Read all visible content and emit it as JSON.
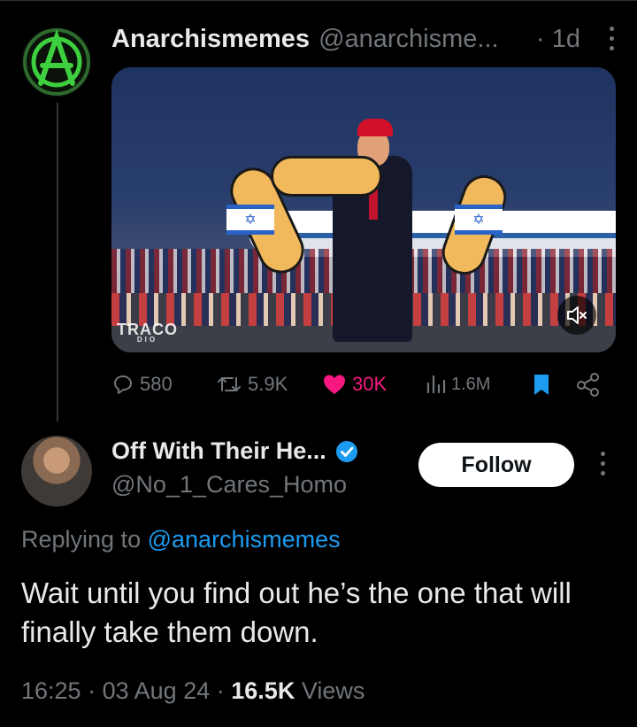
{
  "parent_tweet": {
    "author_name": "Anarchismemes",
    "author_handle": "@anarchisme...",
    "time": "· 1d",
    "video": {
      "watermark": "TRACO",
      "watermark_sub": "DIO"
    },
    "stats": {
      "replies": "580",
      "reposts": "5.9K",
      "likes": "30K",
      "views": "1.6M"
    }
  },
  "reply_tweet": {
    "author_name": "Off With Their He...",
    "author_handle": "@No_1_Cares_Homo",
    "follow_label": "Follow",
    "replying_prefix": "Replying to",
    "replying_handle": "@anarchismemes",
    "text": "Wait until you find out he’s the one that will finally take them down.",
    "time": "16:25",
    "date": "03 Aug 24",
    "views_count": "16.5K",
    "views_label": "Views"
  },
  "colors": {
    "background": "#000000",
    "accent": "#1d9bf0",
    "like": "#f91880",
    "muted": "#71767b",
    "text": "#e7e9ea"
  },
  "icons": [
    "anarchy-logo-icon",
    "more-icon",
    "mute-icon",
    "reply-icon",
    "repost-icon",
    "like-icon",
    "views-icon",
    "bookmark-icon",
    "share-icon",
    "verified-icon"
  ]
}
